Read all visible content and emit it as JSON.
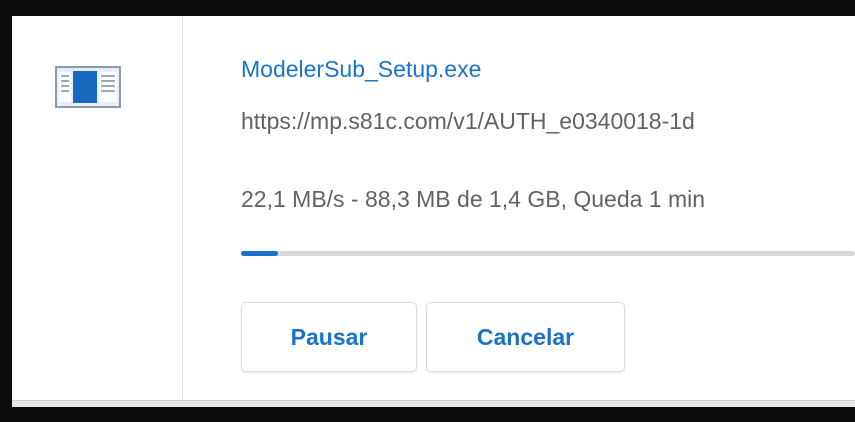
{
  "download": {
    "file_name": "ModelerSub_Setup.exe",
    "url": "https://mp.s81c.com/v1/AUTH_e0340018-1d",
    "status": "22,1 MB/s - 88,3 MB de 1,4 GB, Queda 1 min",
    "progress_fraction": 0.06,
    "icon": "installer-file-icon"
  },
  "actions": {
    "pause_label": "Pausar",
    "cancel_label": "Cancelar"
  },
  "colors": {
    "accent": "#1a73c8",
    "secondary_text": "#5f6368",
    "track": "#d8d8d8"
  }
}
